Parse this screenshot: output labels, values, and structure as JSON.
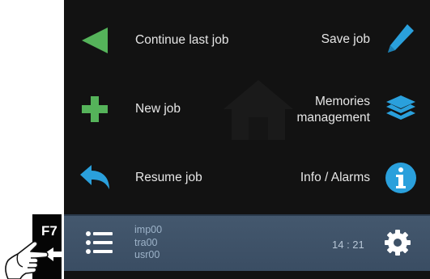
{
  "menu": {
    "continue_last_job": "Continue last job",
    "new_job": "New job",
    "resume_job": "Resume job",
    "save_job": "Save job",
    "memories_line1": "Memories",
    "memories_line2": "management",
    "info_alarms": "Info / Alarms"
  },
  "status": {
    "line1": "imp00",
    "line2": "tra00",
    "line3": "usr00",
    "time": "14 : 21"
  },
  "hardware": {
    "key_label": "F7"
  },
  "icons": {
    "continue": "play-left-icon",
    "new": "plus-icon",
    "resume": "undo-arrow-icon",
    "save": "pencil-icon",
    "memories": "layers-icon",
    "info": "info-icon",
    "list": "list-icon",
    "settings": "gear-icon",
    "background": "home-icon"
  },
  "colors": {
    "green": "#55b35a",
    "blue": "#2aa0dc",
    "screen": "#121212",
    "statusbar": "#3e5267"
  }
}
